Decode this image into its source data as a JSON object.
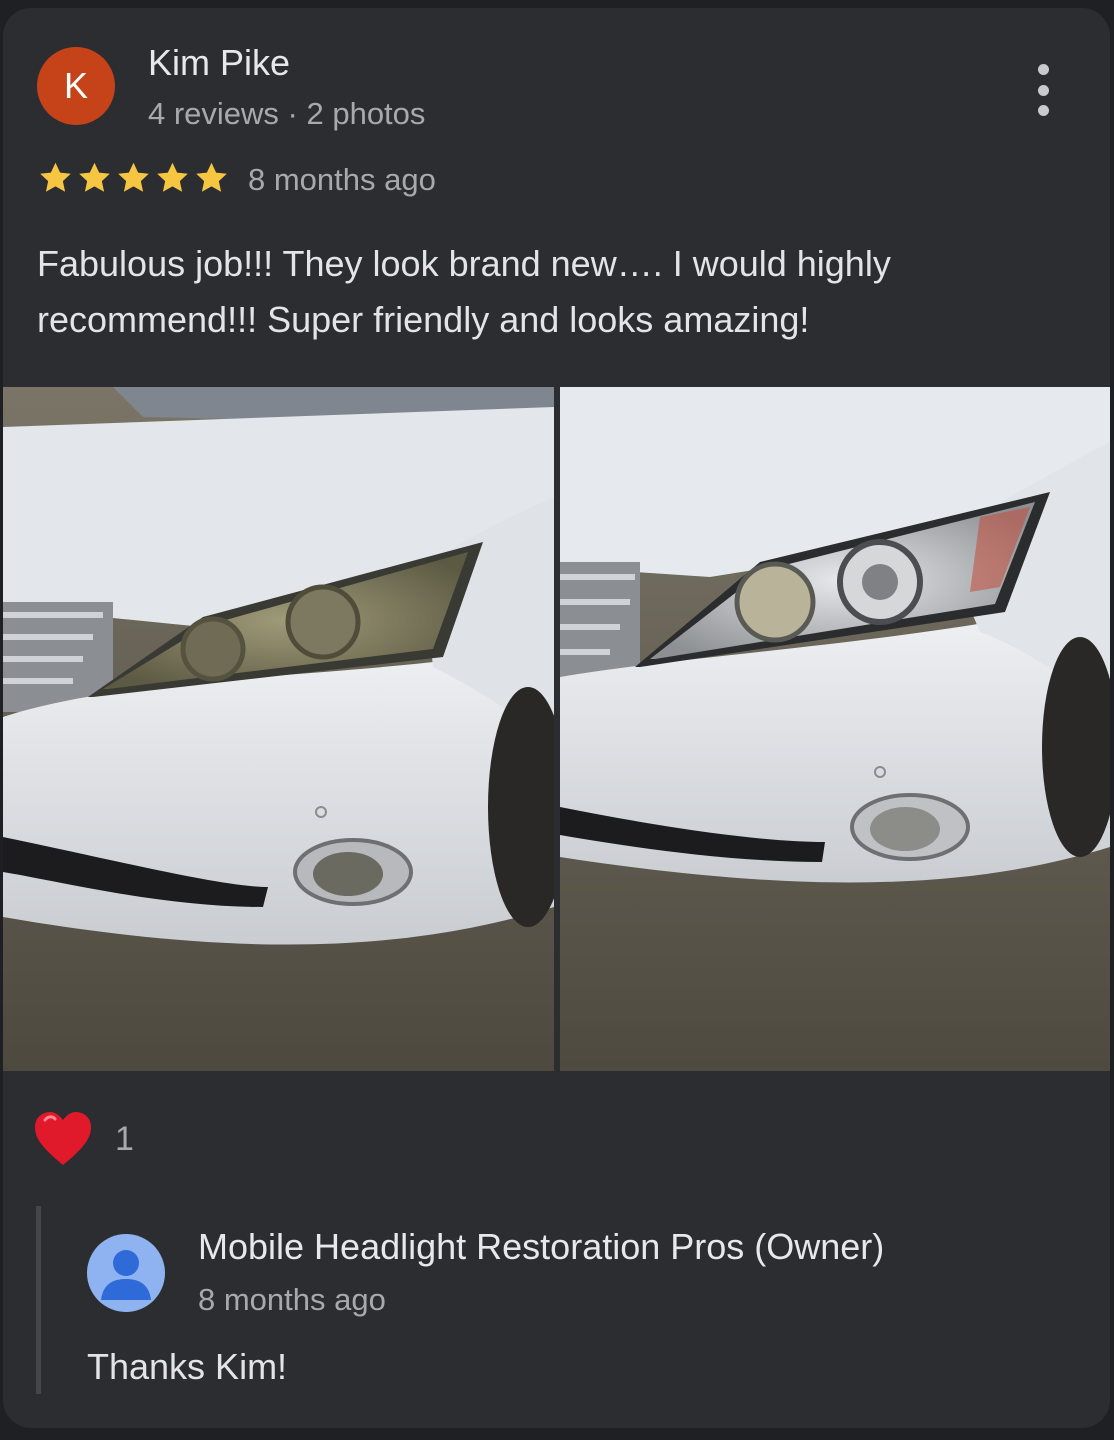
{
  "review": {
    "author": {
      "initial": "K",
      "name": "Kim Pike",
      "meta": "4 reviews · 2 photos",
      "avatar_color": "#c64319"
    },
    "rating": 5,
    "rating_max": 5,
    "time_ago": "8 months ago",
    "text": "Fabulous job!!! They look brand new…. I would highly recommend!!! Super friendly and looks amazing!",
    "photos": [
      {
        "subject": "white car front with cloudy headlight"
      },
      {
        "subject": "white car front with restored clear headlight"
      }
    ],
    "reactions": {
      "icon": "heart-icon",
      "count": "1"
    },
    "reply": {
      "name": "Mobile Headlight Restoration Pros (Owner)",
      "time_ago": "8 months ago",
      "text": "Thanks Kim!"
    }
  },
  "colors": {
    "background": "#1f2024",
    "card": "#2c2d31",
    "star": "#f6c542",
    "heart": "#e0192b",
    "owner_avatar": "#8fb3f0"
  },
  "icons": {
    "more": "more-vertical-icon",
    "star": "star-icon",
    "owner": "person-icon"
  }
}
